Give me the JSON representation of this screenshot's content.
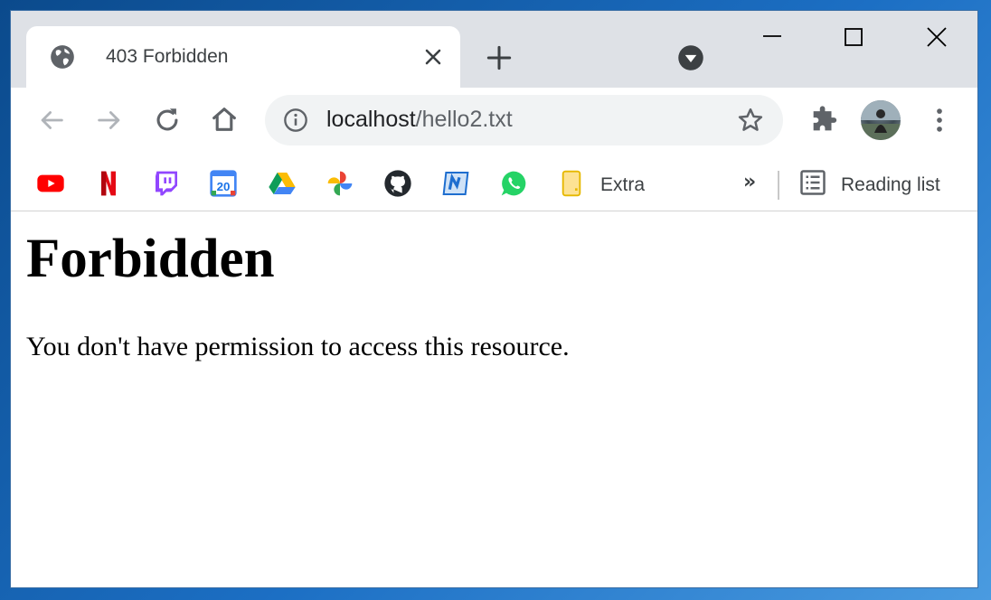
{
  "tab": {
    "title": "403 Forbidden"
  },
  "omnibox": {
    "host": "localhost",
    "path": "/hello2.txt"
  },
  "bookmarks": {
    "items": [
      {
        "icon": "youtube-icon"
      },
      {
        "icon": "netflix-icon"
      },
      {
        "icon": "twitch-icon"
      },
      {
        "icon": "google-calendar-icon",
        "label": "20"
      },
      {
        "icon": "google-drive-icon"
      },
      {
        "icon": "google-photos-icon"
      },
      {
        "icon": "github-icon"
      },
      {
        "icon": "news-icon"
      },
      {
        "icon": "whatsapp-icon"
      }
    ],
    "folder_label": "Extra",
    "more": "»",
    "reading_list": "Reading list"
  },
  "page": {
    "heading": "Forbidden",
    "message": "You don't have permission to access this resource."
  },
  "colors": {
    "tabstrip": "#dee1e6",
    "omnibox": "#f1f3f4",
    "icon": "#5f6368",
    "text": "#3c4043"
  }
}
